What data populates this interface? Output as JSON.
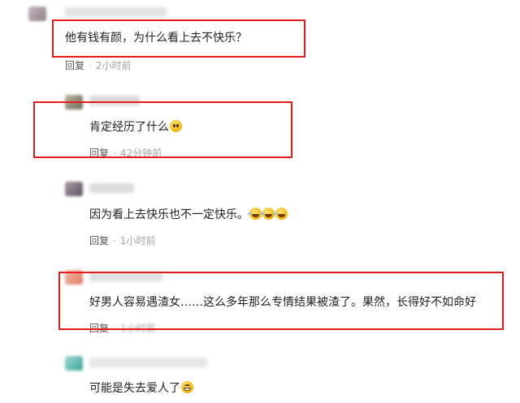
{
  "comments": [
    {
      "text": "他有钱有颜，为什么看上去不快乐？",
      "reply": "回复",
      "dot": "·",
      "time": "2小时前"
    },
    {
      "text": "肯定经历了什么",
      "reply": "回复",
      "dot": "·",
      "time": "42分钟前",
      "emoji": "crying-face"
    },
    {
      "text": "因为看上去快乐也不一定快乐。",
      "reply": "回复",
      "dot": "·",
      "time": "1小时前",
      "emoji": "laughing-tears-face"
    },
    {
      "text": "好男人容易遇渣女……这么多年那么专情结果被渣了。果然，长得好不如命好",
      "reply": "回复",
      "dot": "·",
      "time": "1小时前"
    },
    {
      "text": "可能是失去爱人了",
      "emoji": "grinning-face"
    }
  ],
  "colors": {
    "highlight": "#e31b1b",
    "time": "#a3a3a3",
    "reply": "#555555"
  }
}
